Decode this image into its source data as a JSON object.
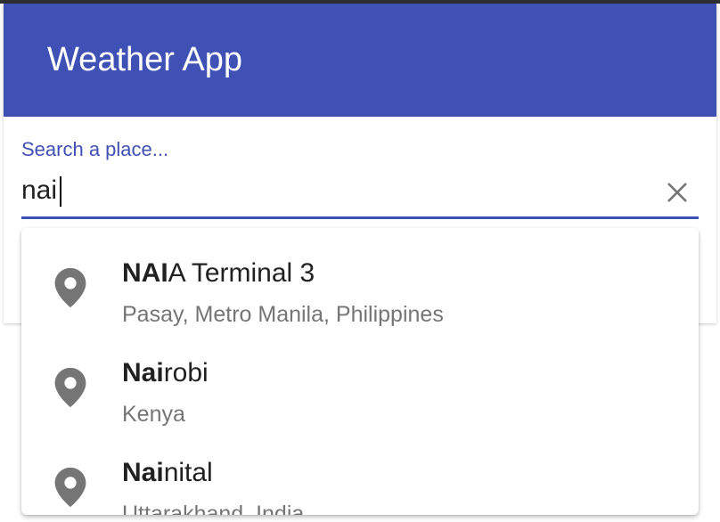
{
  "appbar": {
    "title": "Weather App"
  },
  "search": {
    "label": "Search a place...",
    "value": "nai",
    "clear_icon": "close-icon"
  },
  "suggestions": [
    {
      "match": "NAI",
      "rest": "A Terminal 3",
      "secondary": "Pasay, Metro Manila, Philippines",
      "icon": "location-pin-icon"
    },
    {
      "match": "Nai",
      "rest": "robi",
      "secondary": "Kenya",
      "icon": "location-pin-icon"
    },
    {
      "match": "Nai",
      "rest": "nital",
      "secondary": "Uttarakhand, India",
      "icon": "location-pin-icon"
    }
  ],
  "colors": {
    "primary": "#3f51b5",
    "icon_gray": "#757575",
    "text": "#212121",
    "secondary_text": "#757575"
  }
}
